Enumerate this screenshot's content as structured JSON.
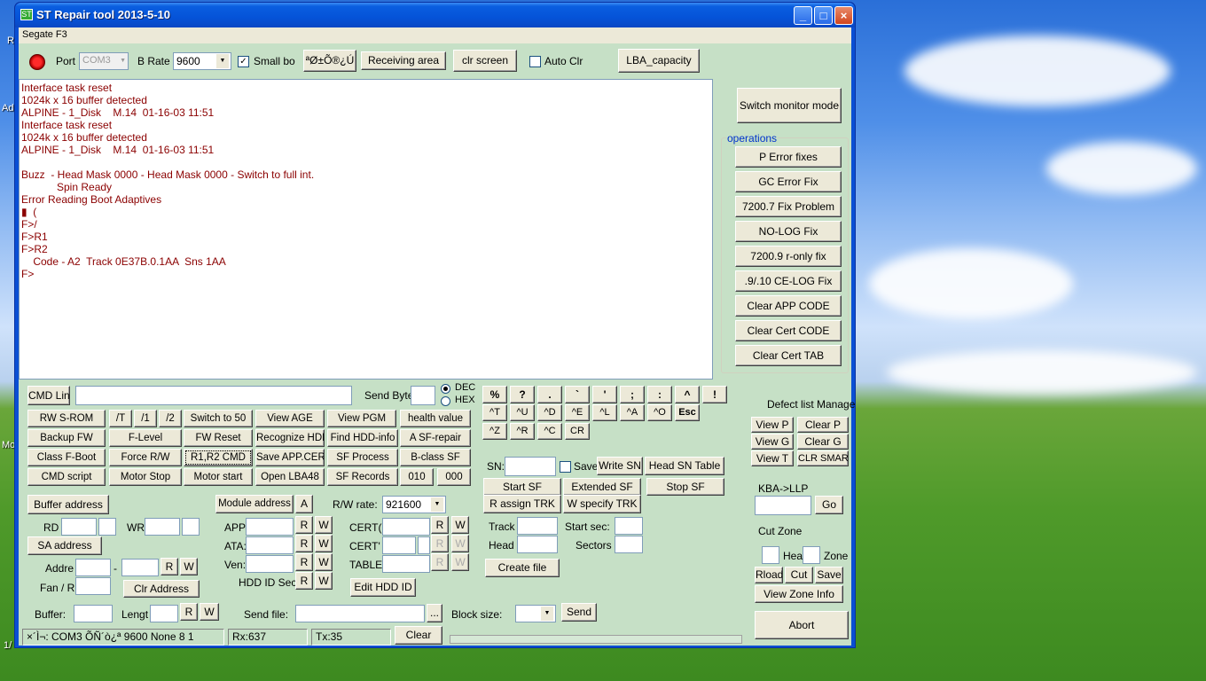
{
  "window": {
    "title": "ST Repair tool 2013-5-10",
    "menu": "Segate F3"
  },
  "colors": {
    "accent": "#0a5ee0",
    "console_text": "#8b0000",
    "panel_bg": "#c6e0c6"
  },
  "toolbar": {
    "port_label": "Port",
    "port_value": "COM3",
    "brate_label": "B Rate",
    "brate_value": "9600",
    "small_box": "Small bo",
    "btn_garbled": "ªØ±Õ®¿Ú",
    "receiving": "Receiving area",
    "clr_screen": "clr screen",
    "auto_clr": "Auto Clr",
    "lba_capacity": "LBA_capacity"
  },
  "console_lines": [
    "Interface task reset",
    "1024k x 16 buffer detected",
    "ALPINE - 1_Disk    M.14  01-16-03 11:51",
    "Interface task reset",
    "1024k x 16 buffer detected",
    "ALPINE - 1_Disk    M.14  01-16-03 11:51",
    "",
    "Buzz  - Head Mask 0000 - Head Mask 0000 - Switch to full int.",
    "            Spin Ready",
    "Error Reading Boot Adaptives",
    "▮  (",
    "F>/",
    "F>R1",
    "F>R2",
    "    Code - A2  Track 0E37B.0.1AA  Sns 1AA",
    "F>"
  ],
  "right": {
    "switch_monitor": "Switch monitor mode",
    "operations_title": "operations",
    "operations": [
      "P Error fixes",
      "GC Error Fix",
      "7200.7 Fix Problem",
      "NO-LOG Fix",
      "7200.9 r-only fix",
      ".9/.10 CE-LOG Fix",
      "Clear APP CODE",
      "Clear Cert CODE",
      "Clear Cert TAB"
    ]
  },
  "cmd": {
    "cmd_line": "CMD Lin",
    "send_byte": "Send Byte",
    "dec": "DEC",
    "hex": "HEX"
  },
  "grid_buttons": [
    [
      "RW S-ROM",
      "/T",
      "/1",
      "/2",
      "Switch to 50",
      "View AGE",
      "View PGM",
      "health value"
    ],
    [
      "Backup FW",
      "F-Level",
      "FW Reset",
      "Recognize HDD",
      "Find HDD-info",
      "A SF-repair"
    ],
    [
      "Class F-Boot",
      "Force R/W",
      "R1,R2 CMD",
      "Save APP.CERT",
      "SF Process",
      "B-class SF"
    ],
    [
      "CMD script",
      "Motor Stop",
      "Motor start",
      "Open LBA48",
      "SF Records",
      "010",
      "000"
    ]
  ],
  "keys": {
    "row1": [
      "%",
      "?",
      ".",
      "`",
      "'",
      ";",
      ":",
      "^",
      "!"
    ],
    "row2": [
      "^T",
      "^U",
      "^D",
      "^E",
      "^L",
      "^A",
      "^O",
      "Esc"
    ],
    "row3": [
      "^Z",
      "^R",
      "^C",
      "CR"
    ]
  },
  "sn": {
    "label": "SN:",
    "save": "Save",
    "write_sn": "Write SN",
    "head_sn_table": "Head SN Table",
    "start_sf": "Start SF",
    "extended_sf": "Extended SF",
    "stop_sf": "Stop SF"
  },
  "defect": {
    "title": "Defect list Manage",
    "view_p": "View P",
    "clear_p": "Clear P",
    "view_g": "View G",
    "clear_g": "Clear G",
    "view_t": "View T",
    "clr_smart": "CLR SMART"
  },
  "buffer": {
    "buffer_address": "Buffer address",
    "rd": "RD",
    "wr": "WR",
    "sa_address": "SA address",
    "addr": "Addre",
    "dash": "-",
    "fan": "Fan / R",
    "clr_address": "Clr Address",
    "r": "R",
    "w": "W"
  },
  "module": {
    "module_address": "Module address",
    "a": "A",
    "app": "APP",
    "ata": "ATA:",
    "ven": "Ven:",
    "hdd_id_sec": "HDD ID Sec",
    "rw_rate_label": "R/W rate:",
    "rw_rate_value": "921600",
    "cert1": "CERT(",
    "cert2": "CERT'",
    "table": "TABLE",
    "edit_hdd_id": "Edit HDD ID"
  },
  "track": {
    "r_assign": "R assign TRK",
    "w_specify": "W specify TRK",
    "track": "Track",
    "head": "Head",
    "start_sec": "Start sec:",
    "sectors": "Sectors",
    "create_file": "Create file"
  },
  "kba": {
    "title": "KBA->LLP",
    "go": "Go",
    "cut_zone": "Cut Zone",
    "hea": "Hea",
    "zone": "Zone",
    "rload": "Rload",
    "cut": "Cut",
    "save": "Save",
    "view_zone_info": "View Zone Info",
    "abort": "Abort"
  },
  "bottom": {
    "buffer": "Buffer:",
    "length": "Lengt",
    "send_file": "Send file:",
    "browse": "...",
    "block_size": "Block size:",
    "send": "Send"
  },
  "statusbar": {
    "conn": "×´Ì¬: COM3 ÕÑ´ò¿ª 9600 None 8 1",
    "rx": "Rx:637",
    "tx": "Tx:35",
    "clear": "Clear"
  },
  "desktop": {
    "icon1": "R",
    "icon2": "Ad",
    "icon3": "Mo",
    "icon4": "1/"
  }
}
